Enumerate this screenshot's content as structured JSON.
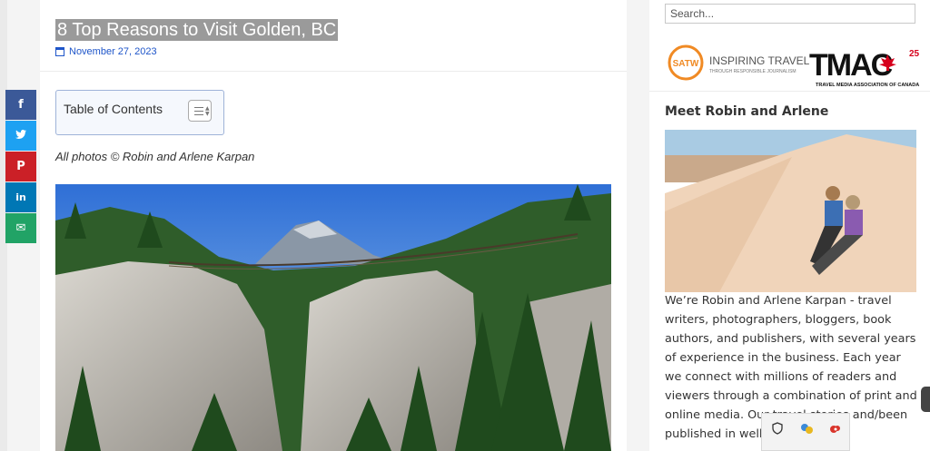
{
  "article": {
    "title": "8 Top Reasons to Visit Golden, BC",
    "date": "November 27, 2023",
    "toc_title": "Table of Contents",
    "photo_credit": "All photos © Robin and Arlene Karpan"
  },
  "share": [
    {
      "name": "facebook",
      "glyph": "f",
      "color": "#3b5998"
    },
    {
      "name": "twitter",
      "glyph": "🐦",
      "color": "#1da1f2"
    },
    {
      "name": "pinterest",
      "glyph": "P",
      "color": "#cb2027"
    },
    {
      "name": "linkedin",
      "glyph": "in",
      "color": "#0077b5"
    },
    {
      "name": "email",
      "glyph": "✉",
      "color": "#21a366"
    }
  ],
  "sidebar": {
    "search_placeholder": "Search...",
    "satw_badge": "SATW",
    "satw_headline": "INSPIRING TRAVEL",
    "satw_sub": "THROUGH RESPONSIBLE JOURNALISM",
    "tmac_mark": "TMAC",
    "tmac_years": "25",
    "tmac_sub": "TRAVEL MEDIA ASSOCIATION OF CANADA",
    "meet_heading": "Meet Robin and Arlene",
    "bio_text": "We’re Robin and Arlene Karpan - travel writers, photographers, bloggers, book authors, and publishers, with several years of experience in the business. Each year we connect with millions of readers and viewers through a combination of print and online media. Our travel stories and/been published in well c tions around"
  },
  "colors": {
    "link": "#1e55c9",
    "title_highlight": "#9a9a9a"
  }
}
